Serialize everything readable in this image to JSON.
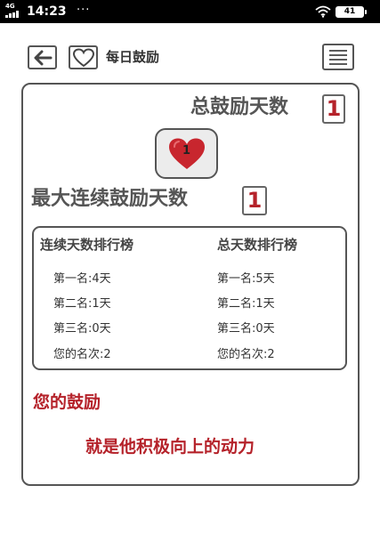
{
  "status_bar": {
    "network": "4G",
    "time": "14:23",
    "dots": "···",
    "battery": "41"
  },
  "header": {
    "title": "每日鼓励"
  },
  "stats": {
    "total_label": "总鼓励天数",
    "total_value": "1",
    "heart_count": "1",
    "max_streak_label": "最大连续鼓励天数",
    "max_streak_value": "1"
  },
  "rankings": {
    "streak": {
      "title": "连续天数排行榜",
      "items": [
        "第一名:4天",
        "第二名:1天",
        "第三名:0天",
        "您的名次:2"
      ]
    },
    "total": {
      "title": "总天数排行榜",
      "items": [
        "第一名:5天",
        "第二名:1天",
        "第三名:0天",
        "您的名次:2"
      ]
    }
  },
  "encouragement": {
    "line1": "您的鼓励",
    "line2": "就是他积极向上的动力"
  },
  "colors": {
    "accent_red": "#b5222a",
    "border": "#555555",
    "heart": "#c8262e"
  }
}
